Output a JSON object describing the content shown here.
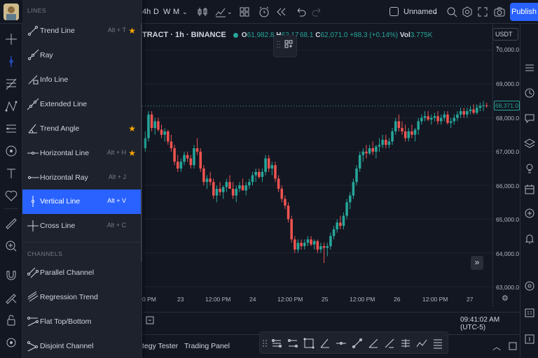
{
  "toolbar": {
    "intervals": [
      "4h",
      "D",
      "W",
      "M"
    ],
    "layout_name": "Unnamed",
    "publish_label": "Publish"
  },
  "symbol": {
    "name": "TRACT · 1h · BINANCE",
    "o_label": "O",
    "o_value": "61,982.8",
    "h_label": "H",
    "h_value": "62,17",
    "c_partial": "68.1",
    "c_label": "C",
    "c_value": "62,071.0",
    "change": "+88.3 (+0.14%)",
    "vol_label": "Vol",
    "vol_value": "3.775K"
  },
  "price_axis": {
    "currency": "USDT",
    "labels": [
      "70,000.0",
      "69,000.0",
      "68,000.0",
      "67,000.0",
      "66,000.0",
      "65,000.0",
      "64,000.0",
      "63,000.0"
    ],
    "last_price": "68,371.0"
  },
  "time_axis": {
    "labels": [
      "0 PM",
      "23",
      "12:00 PM",
      "24",
      "12:00 PM",
      "25",
      "12:00 PM",
      "26",
      "12:00 PM",
      "27"
    ]
  },
  "clock": "09:41:02 AM (UTC-5)",
  "bottom_tabs": [
    "tegy Tester",
    "Trading Panel"
  ],
  "menu": {
    "lines_title": "LINES",
    "channels_title": "CHANNELS",
    "items": [
      {
        "label": "Trend Line",
        "shortcut": "Alt + T",
        "star": true
      },
      {
        "label": "Ray",
        "shortcut": "",
        "star": false
      },
      {
        "label": "Info Line",
        "shortcut": "",
        "star": false
      },
      {
        "label": "Extended Line",
        "shortcut": "",
        "star": false
      },
      {
        "label": "Trend Angle",
        "shortcut": "",
        "star": true
      },
      {
        "label": "Horizontal Line",
        "shortcut": "Alt + H",
        "star": true
      },
      {
        "label": "Horizontal Ray",
        "shortcut": "Alt + J",
        "star": false
      },
      {
        "label": "Vertical Line",
        "shortcut": "Alt + V",
        "star": false,
        "active": true
      },
      {
        "label": "Cross Line",
        "shortcut": "Alt + C",
        "star": false
      }
    ],
    "channel_items": [
      {
        "label": "Parallel Channel"
      },
      {
        "label": "Regression Trend"
      },
      {
        "label": "Flat Top/Bottom"
      },
      {
        "label": "Disjoint Channel"
      }
    ]
  },
  "colors": {
    "up": "#26a69a",
    "down": "#ef5350",
    "accent": "#2962ff",
    "star": "#f7a600",
    "background": "#131722"
  },
  "chart_data": {
    "type": "candlestick",
    "ylim": [
      63000,
      70200
    ],
    "x": [
      "22",
      "22",
      "22",
      "22",
      "22",
      "22",
      "22",
      "22",
      "22",
      "23",
      "23",
      "23",
      "23",
      "23",
      "23",
      "23",
      "23",
      "23",
      "23",
      "23",
      "23",
      "23",
      "23",
      "23",
      "23",
      "23",
      "23",
      "23",
      "23",
      "23",
      "23",
      "23",
      "23",
      "24",
      "24",
      "24",
      "24",
      "24",
      "24",
      "24",
      "24",
      "24",
      "24",
      "24",
      "24",
      "24",
      "24",
      "24",
      "24",
      "24",
      "24",
      "24",
      "24",
      "24",
      "24",
      "24",
      "24",
      "25",
      "25",
      "25",
      "25",
      "25",
      "25",
      "25",
      "25",
      "25",
      "25",
      "25",
      "25",
      "25",
      "25",
      "25",
      "25",
      "25",
      "25",
      "25",
      "25",
      "25",
      "25",
      "25",
      "25",
      "26",
      "26",
      "26",
      "26",
      "26",
      "26",
      "26",
      "26",
      "26",
      "26",
      "26",
      "26",
      "26",
      "26",
      "26",
      "26",
      "26",
      "26",
      "26",
      "26",
      "26",
      "26",
      "26",
      "26",
      "27",
      "27",
      "27",
      "27",
      "27",
      "27",
      "27",
      "27",
      "27"
    ],
    "ohlc": [
      [
        67100,
        67600,
        67000,
        67400
      ],
      [
        67400,
        68200,
        67300,
        68100
      ],
      [
        68100,
        68200,
        67600,
        67700
      ],
      [
        67700,
        68000,
        67500,
        67900
      ],
      [
        67900,
        68000,
        67600,
        67650
      ],
      [
        67650,
        67800,
        67400,
        67500
      ],
      [
        67500,
        67700,
        67300,
        67600
      ],
      [
        67600,
        67650,
        67200,
        67300
      ],
      [
        67300,
        67500,
        67000,
        67100
      ],
      [
        67100,
        67200,
        66600,
        66700
      ],
      [
        66700,
        66900,
        66400,
        66500
      ],
      [
        66500,
        66800,
        66400,
        66700
      ],
      [
        66700,
        67000,
        66600,
        66900
      ],
      [
        66900,
        67000,
        66700,
        66800
      ],
      [
        66800,
        66900,
        66500,
        66600
      ],
      [
        66600,
        67200,
        66500,
        67100
      ],
      [
        67100,
        67400,
        66900,
        67000
      ],
      [
        67000,
        67100,
        66400,
        66500
      ],
      [
        66500,
        66600,
        66000,
        66100
      ],
      [
        66100,
        66300,
        65900,
        66200
      ],
      [
        66200,
        66400,
        66000,
        66100
      ],
      [
        66100,
        66200,
        65600,
        65700
      ],
      [
        65700,
        66000,
        65500,
        65900
      ],
      [
        65900,
        66100,
        65700,
        65800
      ],
      [
        65800,
        66000,
        65600,
        65950
      ],
      [
        65950,
        66200,
        65800,
        66100
      ],
      [
        66100,
        66300,
        65900,
        65900
      ],
      [
        65900,
        66100,
        65600,
        65700
      ],
      [
        65700,
        66000,
        65500,
        65900
      ],
      [
        65900,
        66100,
        65800,
        66000
      ],
      [
        66000,
        66200,
        65900,
        65850
      ],
      [
        65850,
        66100,
        65700,
        66000
      ],
      [
        66000,
        66200,
        65900,
        66100
      ],
      [
        66100,
        66400,
        66000,
        66300
      ],
      [
        66300,
        66500,
        66100,
        66400
      ],
      [
        66400,
        66500,
        66200,
        66250
      ],
      [
        66250,
        66500,
        66100,
        66400
      ],
      [
        66400,
        66900,
        66300,
        66800
      ],
      [
        66800,
        66900,
        66400,
        66500
      ],
      [
        66500,
        66700,
        66300,
        66600
      ],
      [
        66600,
        66700,
        66100,
        66200
      ],
      [
        66200,
        66300,
        65800,
        65900
      ],
      [
        65900,
        66000,
        65500,
        65600
      ],
      [
        65600,
        65700,
        65300,
        65400
      ],
      [
        65400,
        65500,
        64900,
        65000
      ],
      [
        65000,
        65100,
        64300,
        64400
      ],
      [
        64400,
        64500,
        64000,
        64100
      ],
      [
        64100,
        64400,
        64000,
        64300
      ],
      [
        64300,
        64400,
        64100,
        64200
      ],
      [
        64200,
        64400,
        64100,
        64300
      ],
      [
        64300,
        64500,
        64200,
        64400
      ],
      [
        64400,
        64500,
        64200,
        64250
      ],
      [
        64250,
        64400,
        64100,
        64350
      ],
      [
        64350,
        64400,
        64000,
        64100
      ],
      [
        64100,
        64300,
        64000,
        64200
      ],
      [
        64200,
        64300,
        63700,
        64150
      ],
      [
        64150,
        64300,
        63900,
        64200
      ],
      [
        64200,
        64600,
        64100,
        64500
      ],
      [
        64500,
        64800,
        64400,
        64700
      ],
      [
        64700,
        65000,
        64600,
        64900
      ],
      [
        64900,
        65100,
        64700,
        64800
      ],
      [
        64800,
        65200,
        64700,
        65100
      ],
      [
        65100,
        65600,
        65000,
        65500
      ],
      [
        65500,
        65800,
        65300,
        65700
      ],
      [
        65700,
        66200,
        65600,
        66100
      ],
      [
        66100,
        66600,
        66000,
        66500
      ],
      [
        66500,
        67000,
        66400,
        66900
      ],
      [
        66900,
        67100,
        66700,
        67000
      ],
      [
        67000,
        67200,
        66800,
        66950
      ],
      [
        66950,
        67200,
        66900,
        67100
      ],
      [
        67100,
        67300,
        66900,
        67000
      ],
      [
        67000,
        67200,
        66800,
        67150
      ],
      [
        67150,
        67400,
        67000,
        67200
      ],
      [
        67200,
        67500,
        67100,
        67350
      ],
      [
        67350,
        67500,
        67100,
        67200
      ],
      [
        67200,
        67400,
        67100,
        67300
      ],
      [
        67300,
        67700,
        67200,
        67600
      ],
      [
        67600,
        68000,
        67500,
        67900
      ],
      [
        67900,
        68100,
        67600,
        67700
      ],
      [
        67700,
        67900,
        67500,
        67600
      ],
      [
        67600,
        67800,
        67300,
        67400
      ],
      [
        67400,
        67700,
        67300,
        67600
      ],
      [
        67600,
        67800,
        67400,
        67500
      ],
      [
        67500,
        67700,
        67300,
        67650
      ],
      [
        67650,
        68000,
        67500,
        67900
      ],
      [
        67900,
        68100,
        67800,
        68000
      ],
      [
        68000,
        68200,
        67900,
        68050
      ],
      [
        68050,
        68200,
        67900,
        67950
      ],
      [
        67950,
        68100,
        67800,
        68000
      ],
      [
        68000,
        68150,
        67900,
        68050
      ],
      [
        68050,
        68200,
        67800,
        67900
      ],
      [
        67900,
        68100,
        67800,
        68000
      ],
      [
        68000,
        68200,
        67900,
        68100
      ],
      [
        68100,
        68200,
        67800,
        67850
      ],
      [
        67850,
        68000,
        67700,
        67900
      ],
      [
        67900,
        68100,
        67800,
        68000
      ],
      [
        68000,
        68200,
        67900,
        68100
      ],
      [
        68100,
        68300,
        68000,
        68200
      ],
      [
        68200,
        68300,
        68000,
        68100
      ],
      [
        68100,
        68300,
        68000,
        68200
      ],
      [
        68200,
        68350,
        68100,
        68250
      ],
      [
        68250,
        68400,
        68100,
        68150
      ],
      [
        68150,
        68400,
        68100,
        68300
      ],
      [
        68300,
        68450,
        68200,
        68350
      ],
      [
        68350,
        68500,
        68200,
        68371
      ],
      [
        68371,
        68450,
        68300,
        68350
      ]
    ]
  }
}
